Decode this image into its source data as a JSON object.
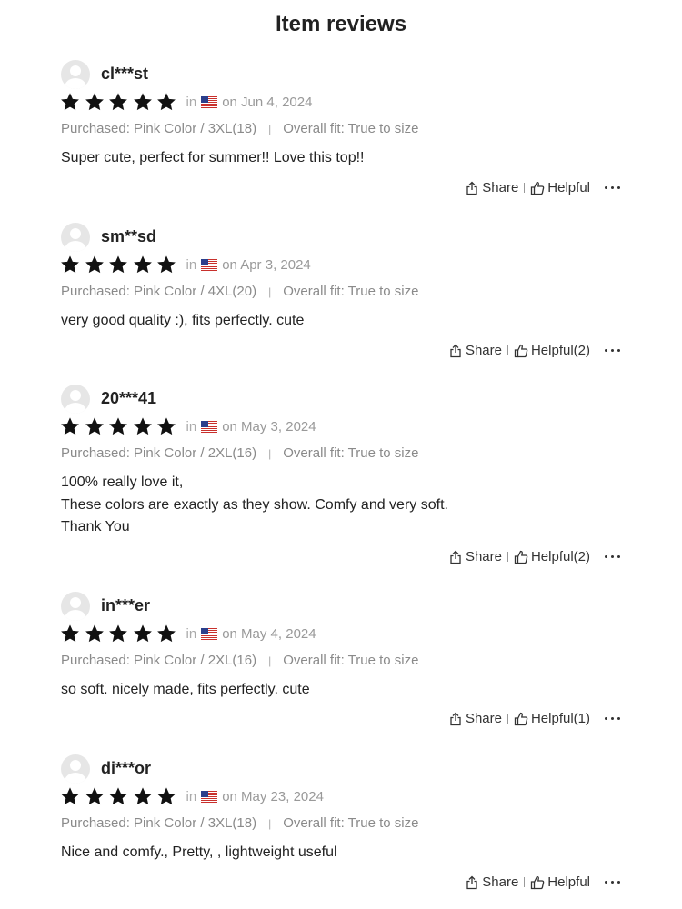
{
  "page": {
    "title": "Item reviews"
  },
  "icons": {
    "avatar": "user-avatar",
    "star": "star-icon",
    "flag": "us-flag-icon",
    "share": "share-icon",
    "helpful": "thumbs-up-icon",
    "more": "more-icon"
  },
  "colors": {
    "star": "#111111",
    "meta": "#8a8a8a"
  },
  "reviews": [
    {
      "user": "cl***st",
      "rating": 5,
      "in": "in",
      "date": "on Jun 4, 2024",
      "purchased": "Purchased: Pink Color / 3XL(18)",
      "fit": "Overall fit: True to size",
      "text": "Super cute, perfect for summer!! Love this top!!",
      "share": "Share",
      "helpful": "Helpful"
    },
    {
      "user": "sm**sd",
      "rating": 5,
      "in": "in",
      "date": "on Apr 3, 2024",
      "purchased": "Purchased: Pink Color / 4XL(20)",
      "fit": "Overall fit: True to size",
      "text": "very good quality :), fits perfectly. cute",
      "share": "Share",
      "helpful": "Helpful(2)"
    },
    {
      "user": "20***41",
      "rating": 5,
      "in": "in",
      "date": "on May 3, 2024",
      "purchased": "Purchased: Pink Color / 2XL(16)",
      "fit": "Overall fit: True to size",
      "text": "100% really love it,\nThese colors are exactly as they show. Comfy and very soft.\nThank You",
      "share": "Share",
      "helpful": "Helpful(2)"
    },
    {
      "user": "in***er",
      "rating": 5,
      "in": "in",
      "date": "on May 4, 2024",
      "purchased": "Purchased: Pink Color / 2XL(16)",
      "fit": "Overall fit: True to size",
      "text": "so soft. nicely made, fits perfectly. cute",
      "share": "Share",
      "helpful": "Helpful(1)"
    },
    {
      "user": "di***or",
      "rating": 5,
      "in": "in",
      "date": "on May 23, 2024",
      "purchased": "Purchased: Pink Color / 3XL(18)",
      "fit": "Overall fit: True to size",
      "text": "Nice and comfy., Pretty, , lightweight useful",
      "share": "Share",
      "helpful": "Helpful"
    }
  ]
}
